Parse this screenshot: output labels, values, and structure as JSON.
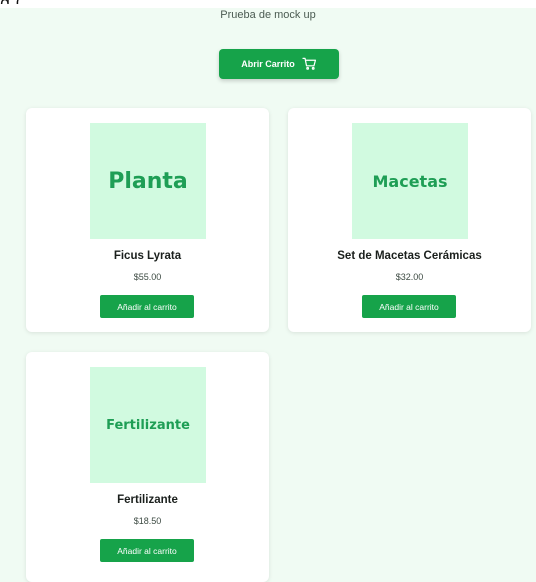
{
  "header": {
    "cut_off_text": "g      (",
    "subtitle": "Prueba de mock up"
  },
  "cart_button": {
    "label": "Abrir Carrito",
    "icon": "cart-icon"
  },
  "products": [
    {
      "image_label": "Planta",
      "name": "Ficus Lyrata",
      "price": "$55.00",
      "button_label": "Añadir al carrito"
    },
    {
      "image_label": "Macetas",
      "name": "Set de Macetas Cerámicas",
      "price": "$32.00",
      "button_label": "Añadir al carrito"
    },
    {
      "image_label": "Fertilizante",
      "name": "Fertilizante",
      "price": "$18.50",
      "button_label": "Añadir al carrito"
    }
  ],
  "colors": {
    "background": "#f0fbf3",
    "accent": "#16a34a",
    "image_bg": "#d1fae0",
    "image_text": "#1e9e55"
  }
}
